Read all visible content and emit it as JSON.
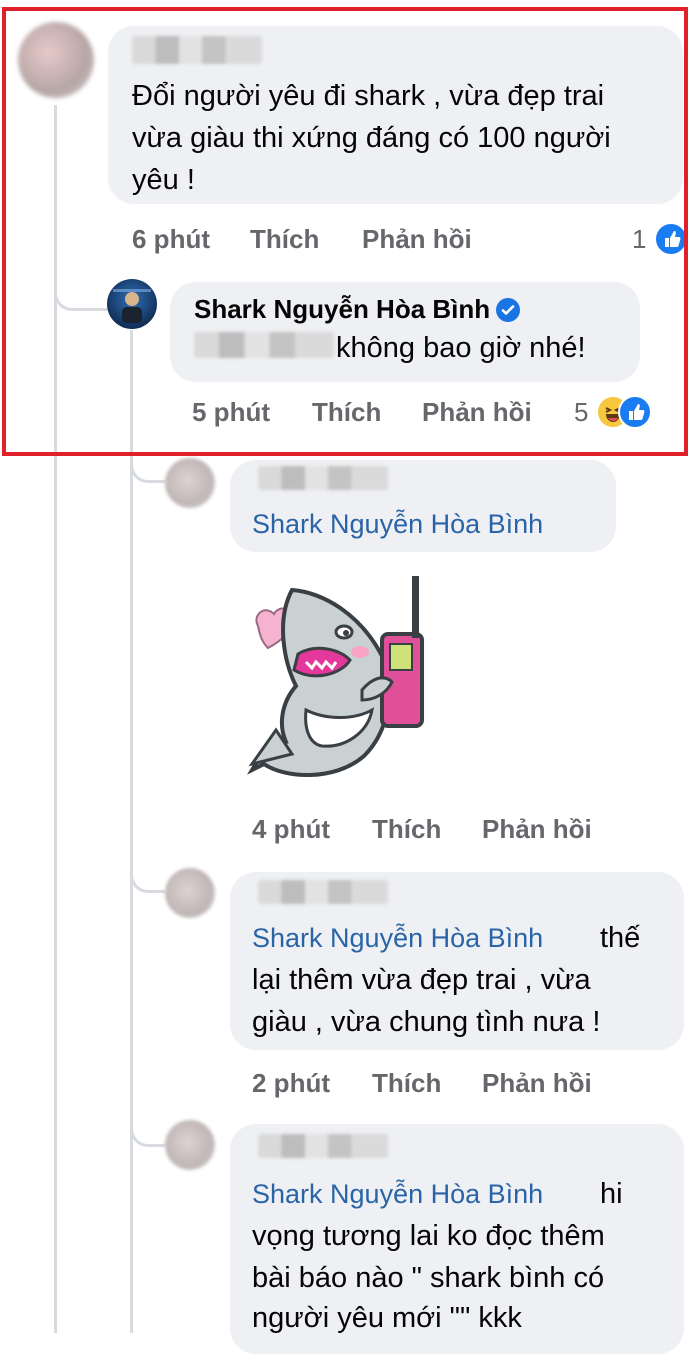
{
  "comments": [
    {
      "id": "c1",
      "author": "",
      "text_lines": [
        "Đổi người yêu đi shark , vừa đẹp trai",
        "vừa giàu thi xứng đáng có 100 người",
        "yêu !"
      ],
      "time": "6 phút",
      "like_label": "Thích",
      "reply_label": "Phản hồi",
      "reaction_count": "1",
      "reactions": [
        "like-icon"
      ]
    },
    {
      "id": "c2",
      "author": "Shark Nguyễn Hòa Bình",
      "verified": true,
      "text": "không bao giờ nhé!",
      "text_prefix_letter": "k",
      "time": "5 phút",
      "like_label": "Thích",
      "reply_label": "Phản hồi",
      "reaction_count": "5",
      "reactions": [
        "haha-icon",
        "like-icon"
      ]
    },
    {
      "id": "c3",
      "author": "",
      "mention": "Shark Nguyễn Hòa Bình",
      "sticker": "shark-with-phone-sticker",
      "time": "4 phút",
      "like_label": "Thích",
      "reply_label": "Phản hồi"
    },
    {
      "id": "c4",
      "author": "",
      "mention": "Shark Nguyễn Hòa Bình",
      "text_first": "thế",
      "text_lines": [
        "lại thêm vừa đẹp trai , vừa",
        "giàu , vừa chung tình nưa !"
      ],
      "time": "2 phút",
      "like_label": "Thích",
      "reply_label": "Phản hồi"
    },
    {
      "id": "c5",
      "author": "",
      "mention": "Shark Nguyễn Hòa Bình",
      "text_first": "hi",
      "text_lines": [
        "vọng tương lai ko đọc thêm",
        "bài báo nào \" shark bình có",
        "người yêu mới \"\" kkk"
      ]
    }
  ],
  "colors": {
    "highlight_border": "#e0202a",
    "bubble": "#eef0f3",
    "mention": "#2a64a8",
    "meta": "#65676b",
    "like_blue": "#1a7cf2"
  }
}
